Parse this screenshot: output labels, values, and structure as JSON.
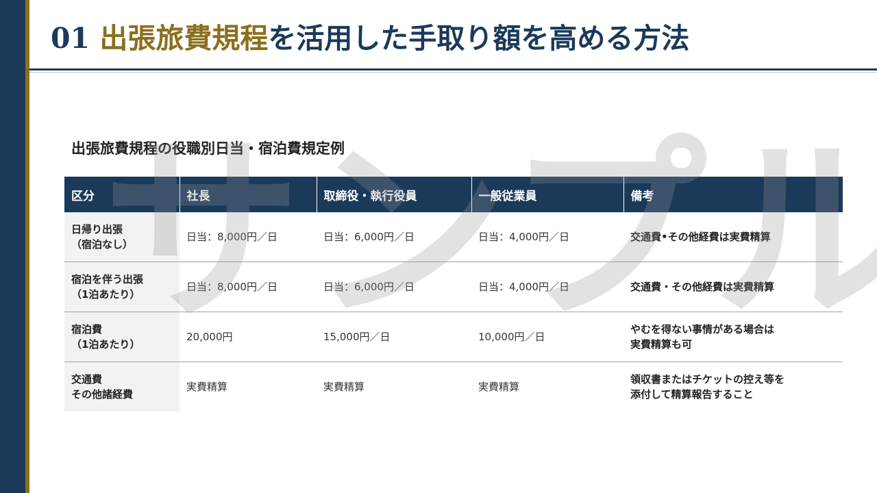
{
  "header": {
    "number": "01",
    "title_highlight": "出張旅費規程",
    "title_rest": "を活用した手取り額を高める方法"
  },
  "section": {
    "subtitle": "出張旅費規程の役職別日当・宿泊費規定例"
  },
  "table": {
    "headers": [
      "区分",
      "社長",
      "取締役・執行役員",
      "一般従業員",
      "備考"
    ],
    "rows": [
      {
        "category": [
          "日帰り出張",
          "（宿泊なし）"
        ],
        "president": "日当：8,000円／日",
        "director": "日当：6,000円／日",
        "employee": "日当：4,000円／日",
        "note": [
          "交通費•その他経費は実費精算"
        ]
      },
      {
        "category": [
          "宿泊を伴う出張",
          "（1泊あたり）"
        ],
        "president": "日当：8,000円／日",
        "director": "日当：6,000円／日",
        "employee": "日当：4,000円／日",
        "note": [
          "交通費・その他経費は実費精算"
        ]
      },
      {
        "category": [
          "宿泊費",
          "（1泊あたり）"
        ],
        "president": "20,000円",
        "director": "15,000円／日",
        "employee": "10,000円／日",
        "note": [
          "やむを得ない事情がある場合は",
          "実費精算も可"
        ]
      },
      {
        "category": [
          "交通費",
          "その他諸経費"
        ],
        "president": "実費精算",
        "director": "実費精算",
        "employee": "実費精算",
        "note": [
          "領収書またはチケットの控え等を",
          "添付して精算報告すること"
        ]
      }
    ]
  },
  "watermark": "サンプル",
  "colors": {
    "navy": "#1b3a5a",
    "gold": "#8b6f1e",
    "row_header_bg": "#f2f2f2"
  }
}
